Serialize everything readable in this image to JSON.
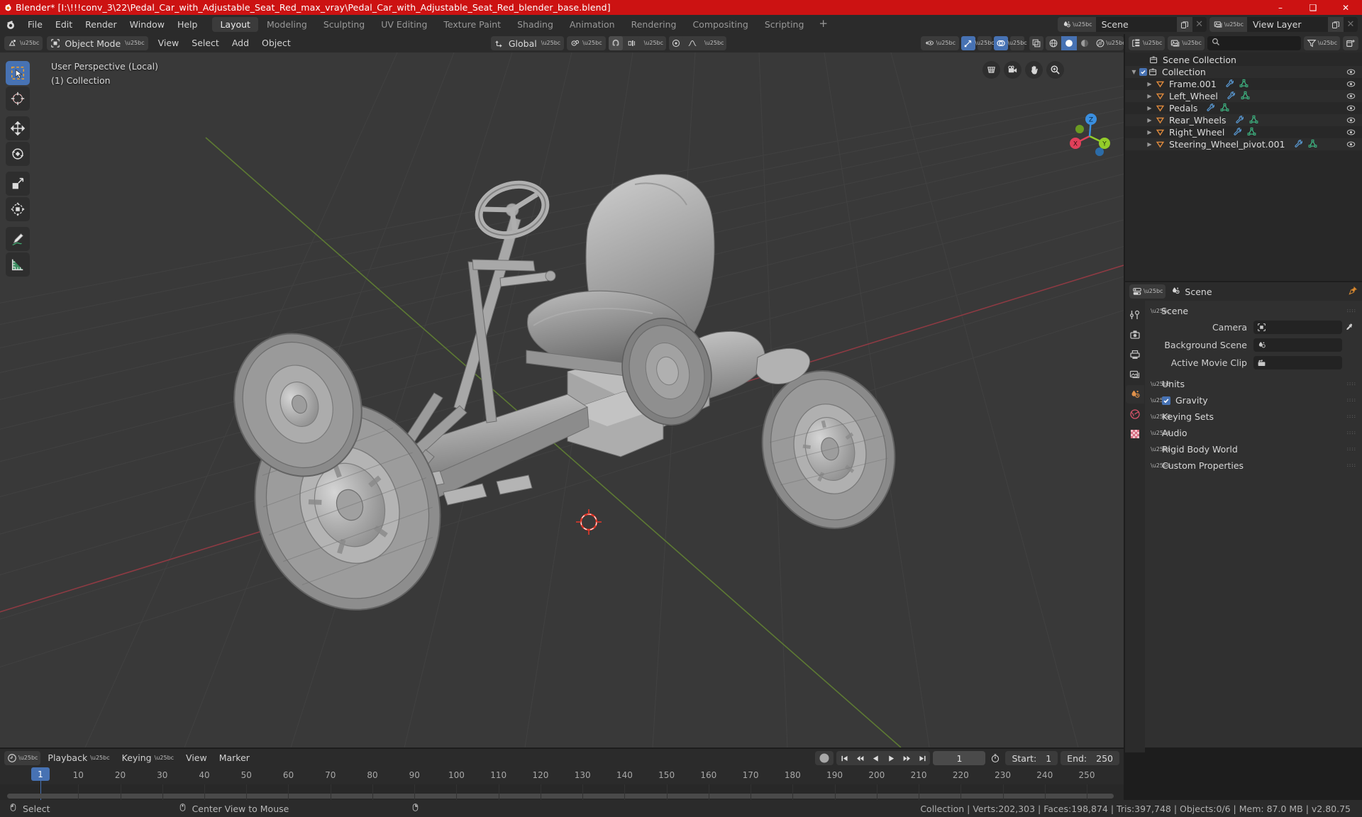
{
  "titlebar": {
    "title": "Blender* [I:\\!!!conv_3\\22\\Pedal_Car_with_Adjustable_Seat_Red_max_vray\\Pedal_Car_with_Adjustable_Seat_Red_blender_base.blend]",
    "icon": "blender-logo-icon",
    "minimize": "–",
    "maximize": "❑",
    "close": "✕",
    "bg_color": "#cc1212"
  },
  "topbar": {
    "menus": [
      "File",
      "Edit",
      "Render",
      "Window",
      "Help"
    ],
    "workspaces": [
      {
        "label": "Layout",
        "active": true
      },
      {
        "label": "Modeling",
        "active": false
      },
      {
        "label": "Sculpting",
        "active": false
      },
      {
        "label": "UV Editing",
        "active": false
      },
      {
        "label": "Texture Paint",
        "active": false
      },
      {
        "label": "Shading",
        "active": false
      },
      {
        "label": "Animation",
        "active": false
      },
      {
        "label": "Rendering",
        "active": false
      },
      {
        "label": "Compositing",
        "active": false
      },
      {
        "label": "Scripting",
        "active": false
      }
    ],
    "add_workspace": "+",
    "scene_field": {
      "icon": "scene-icon",
      "name": "Scene",
      "new_btn": "copy-icon",
      "unlink": "✕"
    },
    "viewlayer_field": {
      "icon": "viewlayer-icon",
      "name": "View Layer",
      "new_btn": "copy-icon",
      "unlink": "✕"
    }
  },
  "viewport": {
    "header": {
      "editor_icon": "editor-type-3dview-icon",
      "mode": "Object Mode",
      "menus": [
        "View",
        "Select",
        "Add",
        "Object"
      ],
      "transform_orientation": "Global",
      "pivot_icon": "pivot-icon",
      "snap_icon": "magnet-icon",
      "snap_target_icon": "snap-increment-icon",
      "proportional_icon": "proportional-edit-icon",
      "falloff_icon": "smooth-falloff-icon",
      "visibility_icon": "object-types-visibility-icon",
      "gizmo_icon": "gizmo-icon",
      "overlays_icon": "overlays-icon",
      "xray_icon": "xray-toggle-icon",
      "shading_modes": [
        {
          "name": "wireframe-shading",
          "active": false
        },
        {
          "name": "solid-shading",
          "active": true
        },
        {
          "name": "material-preview-shading",
          "active": false
        },
        {
          "name": "rendered-shading",
          "active": false
        }
      ]
    },
    "overlay_text_line1": "User Perspective (Local)",
    "overlay_text_line2": "(1) Collection",
    "toolbar": [
      {
        "name": "tweak-select-box-tool",
        "active": true
      },
      {
        "name": "cursor-tool",
        "active": false
      },
      {
        "name": "move-tool",
        "active": false
      },
      {
        "name": "rotate-tool",
        "active": false
      },
      {
        "name": "scale-tool",
        "active": false
      },
      {
        "name": "transform-tool",
        "active": false
      },
      {
        "name": "annotate-tool",
        "active": false
      },
      {
        "name": "measure-tool",
        "active": false
      }
    ],
    "nav_buttons": [
      {
        "name": "toggle-orthographic-icon"
      },
      {
        "name": "camera-view-icon"
      },
      {
        "name": "pan-view-icon"
      },
      {
        "name": "zoom-view-icon"
      }
    ],
    "gizmo_axes": [
      {
        "label": "X",
        "color": "#e0405a"
      },
      {
        "label": "Y",
        "color": "#93cc2a"
      },
      {
        "label": "Z",
        "color": "#3a8fe0"
      }
    ],
    "model_description": "Grey shaded pedal go-kart with four wheels, steering wheel and adjustable seat on a grid floor"
  },
  "outliner": {
    "display_mode_icon": "outliner-display-mode-icon",
    "filter_id_icon": "filter-id-icon",
    "search_placeholder": "",
    "search_value": "",
    "filter_icon": "funnel-filter-icon",
    "new_collection_icon": "new-collection-icon",
    "rows": [
      {
        "label": "Scene Collection",
        "icon": "collection-icon",
        "indent": 0,
        "expander": "",
        "checkbox": false,
        "modifier_icons": [],
        "eye": false
      },
      {
        "label": "Collection",
        "icon": "collection-icon",
        "indent": 1,
        "expander": "▼",
        "checkbox": true,
        "modifier_icons": [],
        "eye": true
      },
      {
        "label": "Frame.001",
        "icon": "mesh-object-icon",
        "indent": 2,
        "expander": "▶",
        "checkbox": false,
        "modifier_icons": [
          "modifier-wrench-icon",
          "mesh-data-icon"
        ],
        "eye": true
      },
      {
        "label": "Left_Wheel",
        "icon": "mesh-object-icon",
        "indent": 2,
        "expander": "▶",
        "checkbox": false,
        "modifier_icons": [
          "modifier-wrench-icon",
          "mesh-data-icon"
        ],
        "eye": true
      },
      {
        "label": "Pedals",
        "icon": "mesh-object-icon",
        "indent": 2,
        "expander": "▶",
        "checkbox": false,
        "modifier_icons": [
          "modifier-wrench-icon",
          "mesh-data-icon"
        ],
        "eye": true
      },
      {
        "label": "Rear_Wheels",
        "icon": "mesh-object-icon",
        "indent": 2,
        "expander": "▶",
        "checkbox": false,
        "modifier_icons": [
          "modifier-wrench-icon",
          "mesh-data-icon"
        ],
        "eye": true
      },
      {
        "label": "Right_Wheel",
        "icon": "mesh-object-icon",
        "indent": 2,
        "expander": "▶",
        "checkbox": false,
        "modifier_icons": [
          "modifier-wrench-icon",
          "mesh-data-icon"
        ],
        "eye": true
      },
      {
        "label": "Steering_Wheel_pivot.001",
        "icon": "mesh-object-icon",
        "indent": 2,
        "expander": "▶",
        "checkbox": false,
        "modifier_icons": [
          "modifier-wrench-icon",
          "mesh-data-icon"
        ],
        "eye": true
      }
    ]
  },
  "properties": {
    "editor_icon": "editor-type-properties-icon",
    "breadcrumb_icon": "scene-icon",
    "breadcrumb": "Scene",
    "pin_icon": "pin-icon",
    "tabs": [
      {
        "name": "tool-tab",
        "active": false
      },
      {
        "name": "render-tab",
        "active": false
      },
      {
        "name": "output-tab",
        "active": false
      },
      {
        "name": "view-layer-tab",
        "active": false
      },
      {
        "name": "scene-tab",
        "active": true
      },
      {
        "name": "world-tab",
        "active": false
      },
      {
        "name": "texture-tab",
        "active": false
      }
    ],
    "panel_title": "Scene",
    "fields": [
      {
        "label": "Camera",
        "value": "",
        "icon": "camera-data-icon",
        "eyedropper": true
      },
      {
        "label": "Background Scene",
        "value": "",
        "icon": "scene-icon",
        "eyedropper": false
      },
      {
        "label": "Active Movie Clip",
        "value": "",
        "icon": "clip-icon",
        "eyedropper": false
      }
    ],
    "sections": [
      {
        "label": "Units",
        "expanded": false,
        "checkbox": null
      },
      {
        "label": "Gravity",
        "expanded": false,
        "checkbox": true
      },
      {
        "label": "Keying Sets",
        "expanded": false,
        "checkbox": null
      },
      {
        "label": "Audio",
        "expanded": false,
        "checkbox": null
      },
      {
        "label": "Rigid Body World",
        "expanded": false,
        "checkbox": null
      },
      {
        "label": "Custom Properties",
        "expanded": false,
        "checkbox": null
      }
    ]
  },
  "timeline": {
    "editor_icon": "editor-type-timeline-icon",
    "menus": [
      "Playback",
      "Keying",
      "View",
      "Marker"
    ],
    "record_icon": "auto-keying-record-icon",
    "transport": [
      {
        "name": "jump-to-start-button",
        "glyph": "⏮"
      },
      {
        "name": "jump-to-prev-keyframe-button",
        "glyph": "⏪"
      },
      {
        "name": "play-reverse-button",
        "glyph": "◀"
      },
      {
        "name": "play-button",
        "glyph": "▶"
      },
      {
        "name": "jump-to-next-keyframe-button",
        "glyph": "⏩"
      },
      {
        "name": "jump-to-end-button",
        "glyph": "⏭"
      }
    ],
    "current_frame": "1",
    "use_preview_range_icon": "stopwatch-icon",
    "start_label": "Start:",
    "start_value": "1",
    "end_label": "End:",
    "end_value": "250",
    "ticks": [
      10,
      20,
      30,
      40,
      50,
      60,
      70,
      80,
      90,
      100,
      110,
      120,
      130,
      140,
      150,
      160,
      170,
      180,
      190,
      200,
      210,
      220,
      230,
      240,
      250
    ],
    "playhead_frame": 1,
    "playhead_label": "1"
  },
  "statusbar": {
    "hints": [
      {
        "icon": "mouse-left-icon",
        "label": "Select"
      },
      {
        "icon": "mouse-middle-icon",
        "label": "Center View to Mouse"
      },
      {
        "icon": "mouse-right-icon",
        "label": ""
      }
    ],
    "stats": "Collection | Verts:202,303 | Faces:198,874 | Tris:397,748 | Objects:0/6 | Mem: 87.0 MB | v2.80.75"
  }
}
